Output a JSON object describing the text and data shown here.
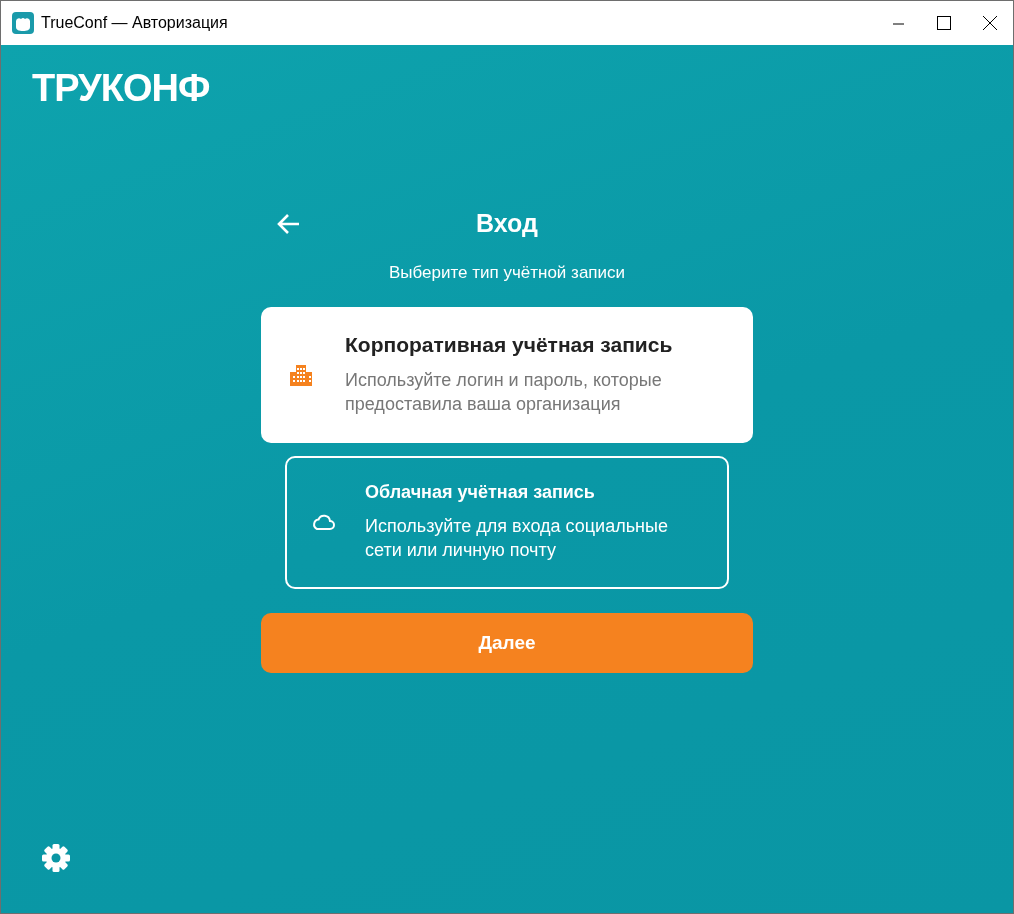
{
  "window": {
    "title": "TrueConf — Авторизация"
  },
  "logo": "ТРУКОНФ",
  "header": {
    "title": "Вход"
  },
  "subtitle": "Выберите тип учётной записи",
  "account_types": [
    {
      "kind": "corporate",
      "title": "Корпоративная учётная запись",
      "description": "Используйте логин и пароль, которые предоставила ваша организация",
      "selected": true
    },
    {
      "kind": "cloud",
      "title": "Облачная учётная запись",
      "description": "Используйте для входа социальные сети или личную почту",
      "selected": false
    }
  ],
  "next_button": "Далее"
}
